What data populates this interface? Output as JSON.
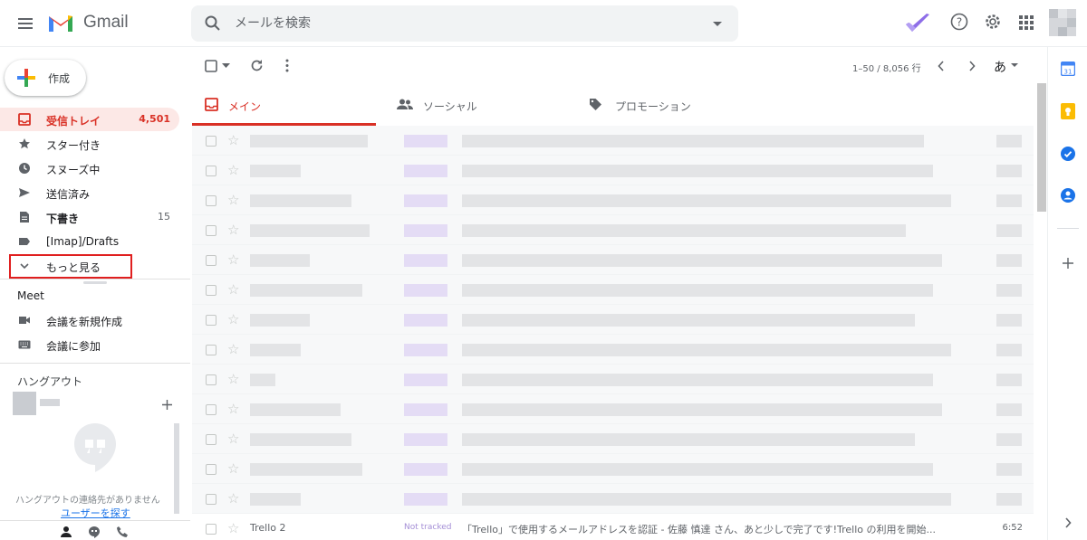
{
  "header": {
    "app_name": "Gmail",
    "search_placeholder": "メールを検索"
  },
  "sidebar": {
    "compose_label": "作成",
    "items": [
      {
        "label": "受信トレイ",
        "count": "4,501"
      },
      {
        "label": "スター付き",
        "count": ""
      },
      {
        "label": "スヌーズ中",
        "count": ""
      },
      {
        "label": "送信済み",
        "count": ""
      },
      {
        "label": "下書き",
        "count": "15"
      },
      {
        "label": "[Imap]/Drafts",
        "count": ""
      },
      {
        "label": "もっと見る",
        "count": ""
      }
    ]
  },
  "meet": {
    "title": "Meet",
    "new_meeting": "会議を新規作成",
    "join_meeting": "会議に参加"
  },
  "hangouts": {
    "title": "ハングアウト",
    "empty_text": "ハングアウトの連絡先がありません",
    "find_link": "ユーザーを探す"
  },
  "toolbar": {
    "pagination": "1–50 / 8,056 行",
    "input_tool": "あ"
  },
  "tabs": [
    {
      "label": "メイン"
    },
    {
      "label": "ソーシャル"
    },
    {
      "label": "プロモーション"
    }
  ],
  "last_row": {
    "sender": "Trello 2",
    "tag": "Not tracked",
    "subject": "「Trello」で使用するメールアドレスを認証 - 佐藤 慎達 さん、あと少しで完了です!Trello の利用を開始...",
    "time": "6:52"
  },
  "colors": {
    "accent_red": "#d93025",
    "highlight_box": "#e01f1f"
  }
}
